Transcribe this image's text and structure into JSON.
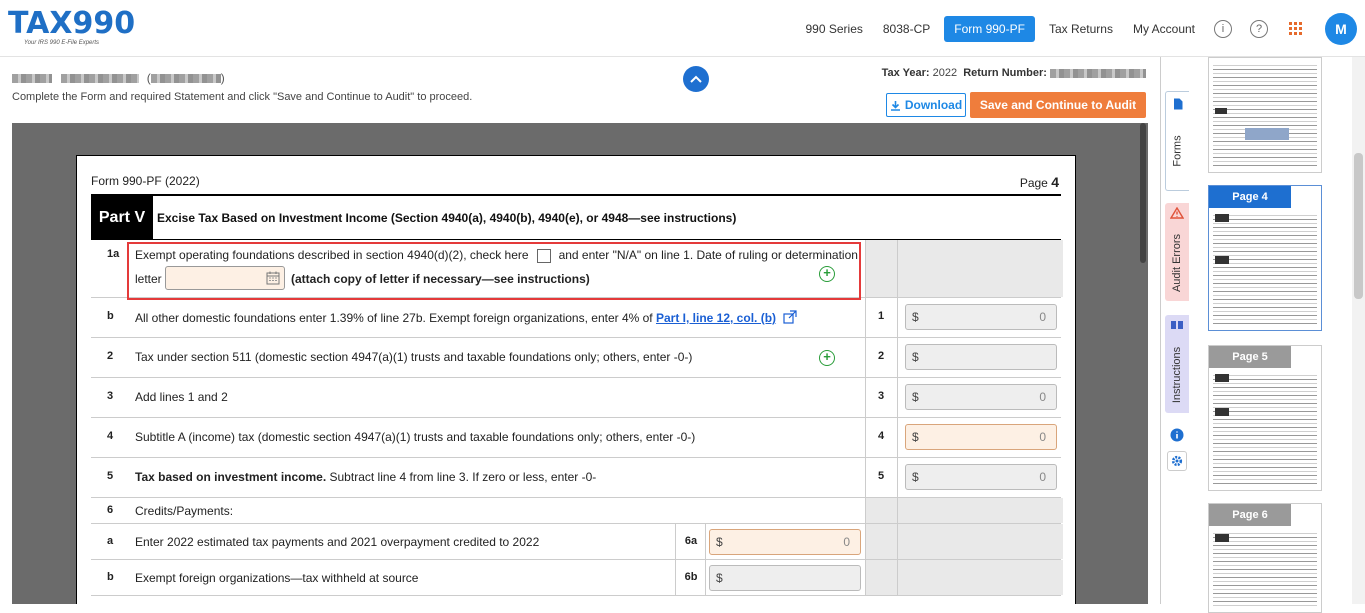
{
  "app": {
    "logo_main": "TAX990",
    "logo_tagline": "Your IRS 990 E-File Experts"
  },
  "nav": {
    "items": [
      "990 Series",
      "8038-CP",
      "Form 990-PF",
      "Tax Returns",
      "My Account"
    ],
    "active": "Form 990-PF",
    "info_glyph": "i",
    "help_glyph": "?",
    "avatar_initial": "M"
  },
  "subheader": {
    "instruction": "Complete the Form and required Statement and click \"Save and Continue to Audit\" to proceed.",
    "tax_year_label": "Tax Year:",
    "tax_year": "2022",
    "return_number_label": "Return Number:",
    "download_label": "Download",
    "save_label": "Save and Continue to Audit"
  },
  "form": {
    "form_name": "Form 990-PF (2022)",
    "page_label": "Page",
    "page_number": "4",
    "part_tag": "Part V",
    "part_title": "Excise Tax Based on Investment Income (Section 4940(a), 4940(b), 4940(e), or 4948—see instructions)",
    "line_1a": {
      "num": "1a",
      "text_a": "Exempt operating foundations described in section 4940(d)(2), check here",
      "text_b": "and enter \"N/A\" on line 1. Date of ruling or determination",
      "text_c": "letter",
      "text_d": "(attach copy of letter if necessary—see instructions)"
    },
    "line_1b": {
      "num": "b",
      "text": "All other domestic foundations enter 1.39% of line 27b. Exempt foreign organizations, enter 4% of",
      "link": "Part I, line 12, col. (b)",
      "box": "1",
      "currency": "$",
      "value": "0"
    },
    "line_2": {
      "num": "2",
      "text": "Tax under section 511 (domestic section 4947(a)(1) trusts and taxable foundations only; others, enter -0-)",
      "box": "2",
      "currency": "$",
      "value": ""
    },
    "line_3": {
      "num": "3",
      "text": "Add lines 1 and 2",
      "box": "3",
      "currency": "$",
      "value": "0"
    },
    "line_4": {
      "num": "4",
      "text": "Subtitle A (income) tax (domestic section 4947(a)(1) trusts and taxable foundations only; others, enter -0-)",
      "box": "4",
      "currency": "$",
      "value": "0"
    },
    "line_5": {
      "num": "5",
      "text_bold": "Tax based on investment income.",
      "text": " Subtract line 4 from line 3. If zero or less, enter -0-",
      "box": "5",
      "currency": "$",
      "value": "0"
    },
    "line_6": {
      "num": "6",
      "text": "Credits/Payments:"
    },
    "line_6a": {
      "num": "a",
      "text": "Enter 2022 estimated tax payments and 2021 overpayment credited to 2022",
      "box": "6a",
      "currency": "$",
      "value": "0"
    },
    "line_6b": {
      "num": "b",
      "text": "Exempt foreign organizations—tax withheld at source",
      "box": "6b",
      "currency": "$",
      "value": ""
    }
  },
  "side_tabs": {
    "forms": "Forms",
    "audit_errors": "Audit Errors",
    "instructions": "Instructions"
  },
  "thumbnails": [
    {
      "label": ""
    },
    {
      "label": "Page 4",
      "active": true
    },
    {
      "label": "Page 5"
    },
    {
      "label": "Page 6"
    }
  ],
  "colors": {
    "brand_blue": "#1e88e5",
    "save_orange": "#ef7d3c",
    "highlight_red": "#e43a3a",
    "plus_green": "#2a9d3a"
  }
}
